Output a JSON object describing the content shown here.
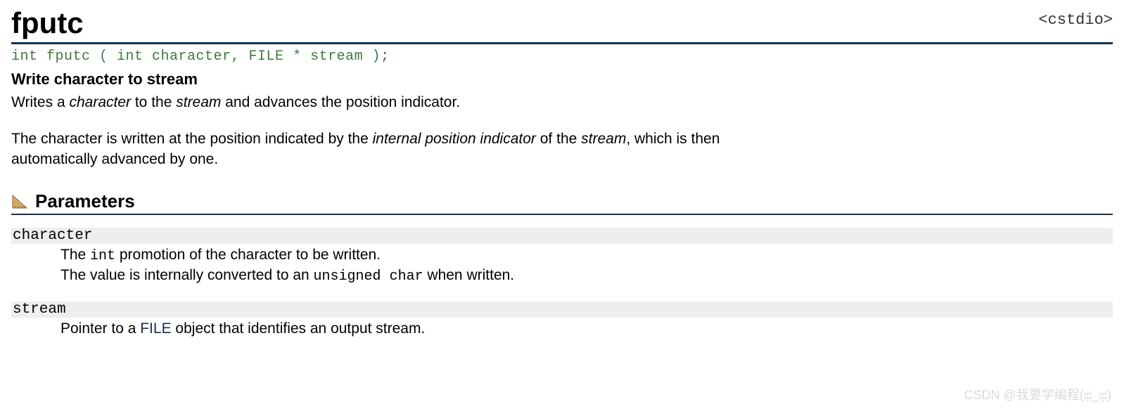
{
  "header": {
    "function_name": "fputc",
    "header_file": "<cstdio>"
  },
  "signature": "int fputc ( int character, FILE * stream );",
  "brief": "Write character to stream",
  "description": {
    "p1_a": "Writes a ",
    "p1_b": "character",
    "p1_c": " to the ",
    "p1_d": "stream",
    "p1_e": " and advances the position indicator.",
    "p2_a": "The character is written at the position indicated by the ",
    "p2_b": "internal position indicator",
    "p2_c": " of the ",
    "p2_d": "stream",
    "p2_e": ", which is then automatically advanced by one."
  },
  "section_parameters_title": "Parameters",
  "params": {
    "character": {
      "name": "character",
      "d1a": "The ",
      "d1b": "int",
      "d1c": " promotion of the character to be written.",
      "d2a": "The value is internally converted to an ",
      "d2b": "unsigned char",
      "d2c": " when written."
    },
    "stream": {
      "name": "stream",
      "d1a": "Pointer to a ",
      "d1b": "FILE",
      "d1c": " object that identifies an output stream."
    }
  },
  "watermark": "CSDN @我要学编程(ಥ_ಥ)"
}
